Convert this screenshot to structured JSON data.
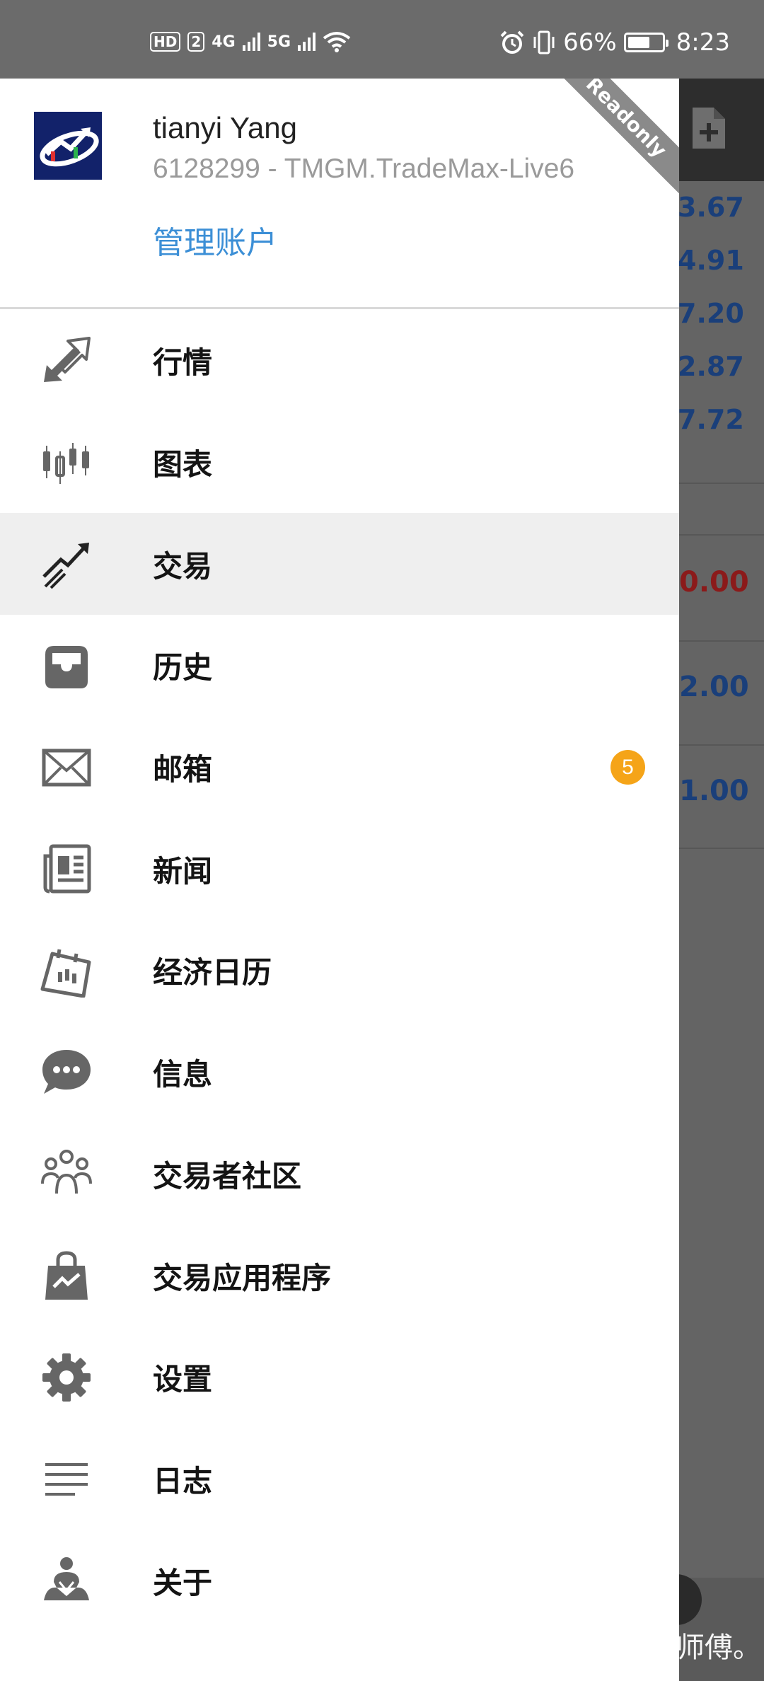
{
  "status_bar": {
    "left_badge": "HD",
    "left_badge_num": "2",
    "net1": "4G",
    "net2": "5G",
    "battery_percent": "66%",
    "time": "8:23"
  },
  "header": {
    "account_name": "tianyi Yang",
    "account_id": "6128299 - TMGM.TradeMax-Live6",
    "manage_link": "管理账户",
    "ribbon": "Readonly"
  },
  "menu": {
    "items": [
      {
        "label": "行情",
        "icon": "quotes-icon"
      },
      {
        "label": "图表",
        "icon": "chart-icon"
      },
      {
        "label": "交易",
        "icon": "trade-icon",
        "active": true
      },
      {
        "label": "历史",
        "icon": "history-icon"
      },
      {
        "label": "邮箱",
        "icon": "mailbox-icon",
        "badge": "5"
      },
      {
        "label": "新闻",
        "icon": "news-icon"
      },
      {
        "label": "经济日历",
        "icon": "calendar-icon"
      },
      {
        "label": "信息",
        "icon": "chat-icon"
      },
      {
        "label": "交易者社区",
        "icon": "community-icon"
      },
      {
        "label": "交易应用程序",
        "icon": "app-store-icon"
      },
      {
        "label": "设置",
        "icon": "gear-icon"
      },
      {
        "label": "日志",
        "icon": "journal-icon"
      },
      {
        "label": "关于",
        "icon": "about-icon"
      }
    ]
  },
  "background": {
    "prices": [
      "3.67",
      "4.91",
      "7.20",
      "2.87",
      "7.72"
    ],
    "trades": [
      {
        "value": "0.00",
        "color": "#8b1a1a"
      },
      {
        "value": "2.00",
        "color": "#1a3f7a"
      },
      {
        "value": "1.00",
        "color": "#1a3f7a"
      }
    ]
  },
  "watermark": "@爆师傅。",
  "colors": {
    "accent_link": "#3c8fd6",
    "badge": "#f5a418",
    "logo_bg": "#12226a"
  }
}
